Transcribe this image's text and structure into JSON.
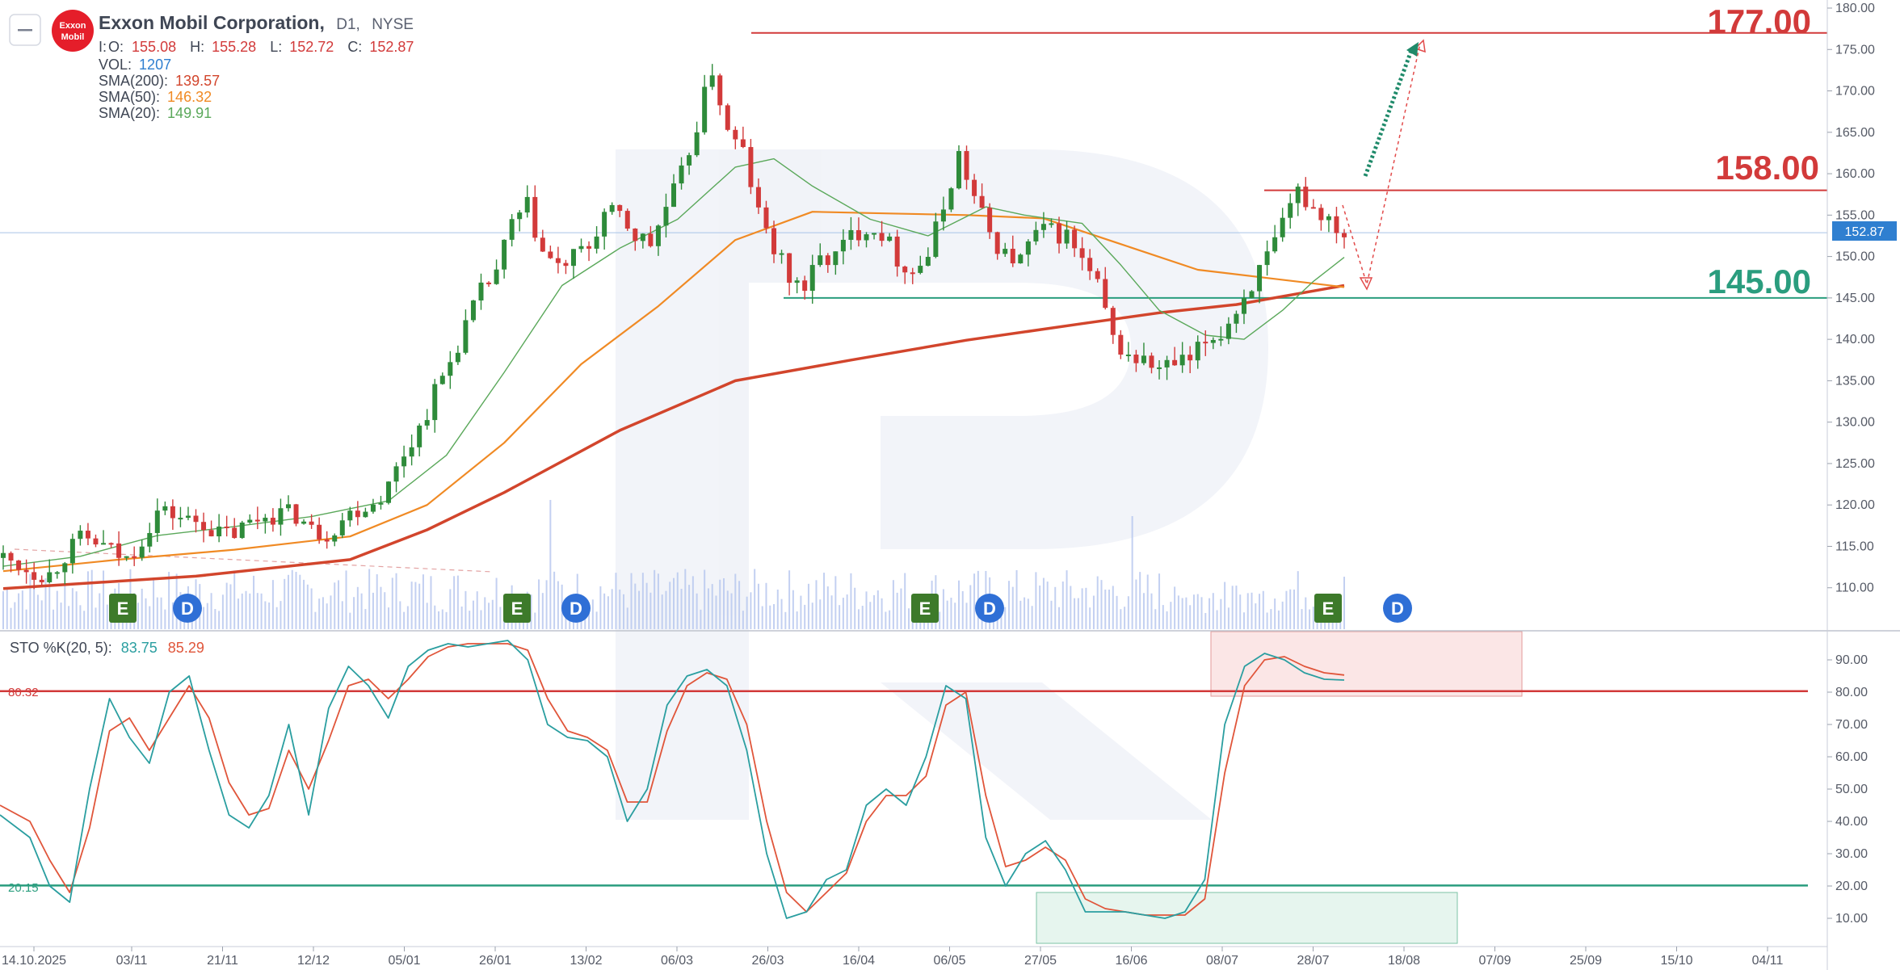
{
  "header": {
    "title": "Exxon Mobil Corporation,",
    "timeframe": "D1,",
    "exchange": "NYSE",
    "logo_text": [
      "Exxon",
      "Mobil"
    ],
    "ohlc_labels": [
      "O:",
      "H:",
      "L:",
      "C:"
    ],
    "ohlc_prefix": "I:",
    "ohlc_values": [
      "155.08",
      "155.28",
      "152.72",
      "152.87"
    ],
    "vol_label": "VOL:",
    "vol_value": "1207",
    "sma": [
      {
        "label": "SMA(200):",
        "value": "139.57",
        "color": "#d2452c"
      },
      {
        "label": "SMA(50):",
        "value": "146.32",
        "color": "#f08a24"
      },
      {
        "label": "SMA(20):",
        "value": "149.91",
        "color": "#5aa85a"
      }
    ],
    "collapse_icon": "minus-icon"
  },
  "colors": {
    "up": "#2e8b3a",
    "down": "#d23a3a",
    "resistance": "#d23a3a",
    "support": "#2a9d7e",
    "sma200": "#d2452c",
    "sma50": "#f08a24",
    "sma20": "#5aa85a",
    "sto_k": "#2a9ea0",
    "sto_d": "#e0553a",
    "price_badge": "#2f7fd0",
    "earnings": "#3d7a2a",
    "dividend": "#2f6fd6"
  },
  "levels": [
    {
      "label": "177.00",
      "value": 177.0,
      "color": "#d23a3a"
    },
    {
      "label": "158.00",
      "value": 158.0,
      "color": "#d23a3a"
    },
    {
      "label": "145.00",
      "value": 145.0,
      "color": "#2a9d7e"
    }
  ],
  "current_price": {
    "label": "152.87",
    "value": 152.87
  },
  "events": [
    {
      "type": "E",
      "date": "31/10"
    },
    {
      "type": "D",
      "date": "12/11"
    },
    {
      "type": "E",
      "date": "30/01"
    },
    {
      "type": "D",
      "date": "11/02"
    },
    {
      "type": "E",
      "date": "02/05"
    },
    {
      "type": "D",
      "date": "14/05"
    },
    {
      "type": "E",
      "date": "01/08"
    },
    {
      "type": "D",
      "date": "13/08"
    }
  ],
  "stochastic": {
    "label": "STO %K(20, 5):",
    "k_value": "83.75",
    "d_value": "85.29",
    "overbought": {
      "label": "80.32",
      "value": 80.32
    },
    "oversold": {
      "label": "20.15",
      "value": 20.15
    }
  },
  "chart_data": {
    "type": "candlestick",
    "symbol": "XOM",
    "x_axis_ticks": [
      "14.10.2025",
      "03/11",
      "21/11",
      "12/12",
      "05/01",
      "26/01",
      "13/02",
      "06/03",
      "26/03",
      "16/04",
      "06/05",
      "27/05",
      "16/06",
      "08/07",
      "28/07",
      "18/08",
      "07/09",
      "25/09",
      "15/10",
      "04/11"
    ],
    "price_axis_ticks": [
      "180.00",
      "175.00",
      "170.00",
      "165.00",
      "160.00",
      "155.00",
      "150.00",
      "145.00",
      "140.00",
      "135.00",
      "130.00",
      "125.00",
      "120.00",
      "115.00",
      "110.00"
    ],
    "price_range": [
      105,
      180
    ],
    "sto_axis_ticks": [
      "90.00",
      "80.00",
      "70.00",
      "60.00",
      "50.00",
      "40.00",
      "30.00",
      "20.00",
      "10.00"
    ],
    "sto_range": [
      3,
      98
    ],
    "close_series": [
      [
        0,
        113.6
      ],
      [
        4,
        112.8
      ],
      [
        8,
        112.0
      ],
      [
        12,
        111.6
      ],
      [
        16,
        114.0
      ],
      [
        20,
        115.8
      ],
      [
        24,
        115.5
      ],
      [
        28,
        114.4
      ],
      [
        32,
        113.4
      ],
      [
        36,
        116.0
      ],
      [
        40,
        119.2
      ],
      [
        44,
        118.9
      ],
      [
        48,
        118.1
      ],
      [
        52,
        117.9
      ],
      [
        56,
        116.4
      ],
      [
        60,
        116.6
      ],
      [
        64,
        117.8
      ],
      [
        68,
        118.8
      ],
      [
        72,
        119.0
      ],
      [
        76,
        118.8
      ],
      [
        80,
        116.9
      ],
      [
        84,
        116.6
      ],
      [
        88,
        118.3
      ],
      [
        92,
        119.6
      ],
      [
        96,
        120.3
      ],
      [
        100,
        122.3
      ],
      [
        104,
        126.3
      ],
      [
        108,
        129.3
      ],
      [
        112,
        133.6
      ],
      [
        116,
        137.3
      ],
      [
        120,
        141.7
      ],
      [
        124,
        145.6
      ],
      [
        128,
        148.3
      ],
      [
        132,
        153.8
      ],
      [
        136,
        155.9
      ],
      [
        140,
        150.5
      ],
      [
        144,
        148.6
      ],
      [
        148,
        149.8
      ],
      [
        152,
        151.1
      ],
      [
        156,
        155.1
      ],
      [
        160,
        154.8
      ],
      [
        164,
        152.5
      ],
      [
        168,
        151.5
      ],
      [
        172,
        155.9
      ],
      [
        176,
        159.7
      ],
      [
        180,
        166.0
      ],
      [
        184,
        172.6
      ],
      [
        188,
        164.9
      ],
      [
        192,
        162.6
      ],
      [
        196,
        155.1
      ],
      [
        200,
        151.0
      ],
      [
        204,
        147.4
      ],
      [
        208,
        146.3
      ],
      [
        212,
        149.6
      ],
      [
        216,
        150.0
      ],
      [
        220,
        152.5
      ],
      [
        224,
        153.7
      ],
      [
        228,
        152.9
      ],
      [
        232,
        149.8
      ],
      [
        236,
        148.2
      ],
      [
        240,
        150.2
      ],
      [
        244,
        156.0
      ],
      [
        248,
        162.3
      ],
      [
        252,
        157.0
      ],
      [
        256,
        152.8
      ],
      [
        260,
        150.1
      ],
      [
        264,
        149.6
      ],
      [
        268,
        152.8
      ],
      [
        272,
        153.0
      ],
      [
        276,
        152.5
      ],
      [
        280,
        149.4
      ],
      [
        284,
        146.3
      ],
      [
        288,
        139.9
      ],
      [
        292,
        137.9
      ],
      [
        296,
        137.3
      ],
      [
        300,
        136.3
      ],
      [
        304,
        137.0
      ],
      [
        308,
        137.2
      ],
      [
        312,
        139.8
      ],
      [
        316,
        140.8
      ],
      [
        320,
        143.5
      ],
      [
        324,
        146.8
      ],
      [
        328,
        149.6
      ],
      [
        332,
        153.4
      ],
      [
        336,
        157.8
      ],
      [
        340,
        155.9
      ],
      [
        344,
        154.7
      ],
      [
        348,
        152.87
      ]
    ],
    "series": [
      {
        "name": "SMA(200)",
        "values": [
          [
            0,
            109.9
          ],
          [
            50,
            111.4
          ],
          [
            90,
            113.4
          ],
          [
            110,
            117.0
          ],
          [
            130,
            121.5
          ],
          [
            160,
            129.0
          ],
          [
            190,
            135.0
          ],
          [
            220,
            137.5
          ],
          [
            250,
            139.9
          ],
          [
            280,
            141.9
          ],
          [
            300,
            143.2
          ],
          [
            320,
            144.2
          ],
          [
            348,
            146.5
          ]
        ]
      },
      {
        "name": "SMA(50)",
        "values": [
          [
            0,
            112.0
          ],
          [
            30,
            113.4
          ],
          [
            60,
            114.6
          ],
          [
            90,
            116.2
          ],
          [
            110,
            120.0
          ],
          [
            130,
            127.5
          ],
          [
            150,
            137.0
          ],
          [
            170,
            144.0
          ],
          [
            190,
            152.0
          ],
          [
            210,
            155.4
          ],
          [
            230,
            155.2
          ],
          [
            250,
            155.0
          ],
          [
            270,
            154.6
          ],
          [
            290,
            151.5
          ],
          [
            310,
            148.4
          ],
          [
            330,
            147.3
          ],
          [
            348,
            146.3
          ]
        ]
      },
      {
        "name": "SMA(20)",
        "values": [
          [
            0,
            112.6
          ],
          [
            20,
            113.8
          ],
          [
            40,
            116.3
          ],
          [
            60,
            117.4
          ],
          [
            80,
            118.6
          ],
          [
            100,
            120.5
          ],
          [
            115,
            126.0
          ],
          [
            130,
            136.0
          ],
          [
            145,
            146.5
          ],
          [
            160,
            151.0
          ],
          [
            175,
            154.5
          ],
          [
            190,
            160.8
          ],
          [
            200,
            161.8
          ],
          [
            210,
            158.5
          ],
          [
            225,
            154.5
          ],
          [
            240,
            152.5
          ],
          [
            255,
            156.0
          ],
          [
            265,
            155.0
          ],
          [
            280,
            154.0
          ],
          [
            290,
            149.0
          ],
          [
            300,
            143.5
          ],
          [
            312,
            140.5
          ],
          [
            322,
            140.0
          ],
          [
            332,
            143.5
          ],
          [
            340,
            147.0
          ],
          [
            348,
            149.9
          ]
        ]
      }
    ],
    "stochastic_k": [
      [
        0,
        42
      ],
      [
        6,
        35
      ],
      [
        10,
        20
      ],
      [
        14,
        15
      ],
      [
        18,
        50
      ],
      [
        22,
        78
      ],
      [
        26,
        66
      ],
      [
        30,
        58
      ],
      [
        34,
        80
      ],
      [
        38,
        85
      ],
      [
        42,
        62
      ],
      [
        46,
        42
      ],
      [
        50,
        38
      ],
      [
        54,
        48
      ],
      [
        58,
        70
      ],
      [
        62,
        42
      ],
      [
        66,
        75
      ],
      [
        70,
        88
      ],
      [
        74,
        82
      ],
      [
        78,
        72
      ],
      [
        82,
        88
      ],
      [
        86,
        93
      ],
      [
        90,
        95
      ],
      [
        94,
        94
      ],
      [
        98,
        95
      ],
      [
        102,
        96
      ],
      [
        106,
        90
      ],
      [
        110,
        70
      ],
      [
        114,
        66
      ],
      [
        118,
        65
      ],
      [
        122,
        60
      ],
      [
        126,
        40
      ],
      [
        130,
        50
      ],
      [
        134,
        76
      ],
      [
        138,
        85
      ],
      [
        142,
        87
      ],
      [
        146,
        82
      ],
      [
        150,
        62
      ],
      [
        154,
        30
      ],
      [
        158,
        10
      ],
      [
        162,
        12
      ],
      [
        166,
        22
      ],
      [
        170,
        25
      ],
      [
        174,
        45
      ],
      [
        178,
        50
      ],
      [
        182,
        45
      ],
      [
        186,
        60
      ],
      [
        190,
        82
      ],
      [
        194,
        78
      ],
      [
        198,
        35
      ],
      [
        202,
        20
      ],
      [
        206,
        30
      ],
      [
        210,
        34
      ],
      [
        214,
        25
      ],
      [
        218,
        12
      ],
      [
        222,
        12
      ],
      [
        226,
        12
      ],
      [
        230,
        11
      ],
      [
        234,
        10
      ],
      [
        238,
        12
      ],
      [
        242,
        22
      ],
      [
        246,
        70
      ],
      [
        250,
        88
      ],
      [
        254,
        92
      ],
      [
        258,
        90
      ],
      [
        262,
        86
      ],
      [
        266,
        84
      ],
      [
        270,
        83.75
      ]
    ],
    "stochastic_d": [
      [
        0,
        45
      ],
      [
        6,
        40
      ],
      [
        10,
        28
      ],
      [
        14,
        18
      ],
      [
        18,
        38
      ],
      [
        22,
        68
      ],
      [
        26,
        72
      ],
      [
        30,
        62
      ],
      [
        34,
        72
      ],
      [
        38,
        82
      ],
      [
        42,
        72
      ],
      [
        46,
        52
      ],
      [
        50,
        42
      ],
      [
        54,
        44
      ],
      [
        58,
        62
      ],
      [
        62,
        50
      ],
      [
        66,
        65
      ],
      [
        70,
        82
      ],
      [
        74,
        84
      ],
      [
        78,
        78
      ],
      [
        82,
        84
      ],
      [
        86,
        91
      ],
      [
        90,
        94
      ],
      [
        94,
        95
      ],
      [
        98,
        95
      ],
      [
        102,
        95
      ],
      [
        106,
        93
      ],
      [
        110,
        78
      ],
      [
        114,
        68
      ],
      [
        118,
        66
      ],
      [
        122,
        62
      ],
      [
        126,
        46
      ],
      [
        130,
        46
      ],
      [
        134,
        68
      ],
      [
        138,
        82
      ],
      [
        142,
        86
      ],
      [
        146,
        84
      ],
      [
        150,
        70
      ],
      [
        154,
        40
      ],
      [
        158,
        18
      ],
      [
        162,
        12
      ],
      [
        166,
        18
      ],
      [
        170,
        24
      ],
      [
        174,
        40
      ],
      [
        178,
        48
      ],
      [
        182,
        48
      ],
      [
        186,
        54
      ],
      [
        190,
        76
      ],
      [
        194,
        80
      ],
      [
        198,
        48
      ],
      [
        202,
        26
      ],
      [
        206,
        28
      ],
      [
        210,
        32
      ],
      [
        214,
        28
      ],
      [
        218,
        16
      ],
      [
        222,
        13
      ],
      [
        226,
        12
      ],
      [
        230,
        11
      ],
      [
        234,
        11
      ],
      [
        238,
        11
      ],
      [
        242,
        16
      ],
      [
        246,
        55
      ],
      [
        250,
        82
      ],
      [
        254,
        90
      ],
      [
        258,
        91
      ],
      [
        262,
        88
      ],
      [
        266,
        86
      ],
      [
        270,
        85.29
      ]
    ]
  }
}
